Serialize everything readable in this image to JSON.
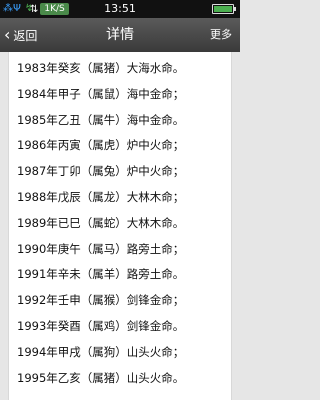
{
  "status_bar": {
    "icons": [
      "signal-icon",
      "wifi-icon",
      "app-icon"
    ],
    "speed": "1K/S",
    "time": "13:51",
    "battery_level": 0.9,
    "signal_text": "⁂Ψ",
    "wifi_text": "↯"
  },
  "title_bar": {
    "back_label": "返回",
    "back_icon": "‹",
    "title": "详情",
    "more_label": "更多"
  },
  "items": [
    "1983年癸亥（属猪）大海水命。",
    "1984年甲子（属鼠）海中金命；",
    "1985年乙丑（属牛）海中金命。",
    "1986年丙寅（属虎）炉中火命；",
    "1987年丁卯（属兔）炉中火命；",
    "1988年戊辰（属龙）大林木命；",
    "1989年已巳（属蛇）大林木命。",
    "1990年庚午（属马）路旁土命；",
    "1991年辛未（属羊）路旁土命。",
    "1992年壬申（属猴）剑锋金命；",
    "1993年癸酉（属鸡）剑锋金命。",
    "1994年甲戌（属狗）山头火命；",
    "1995年乙亥（属猪）山头火命。"
  ]
}
